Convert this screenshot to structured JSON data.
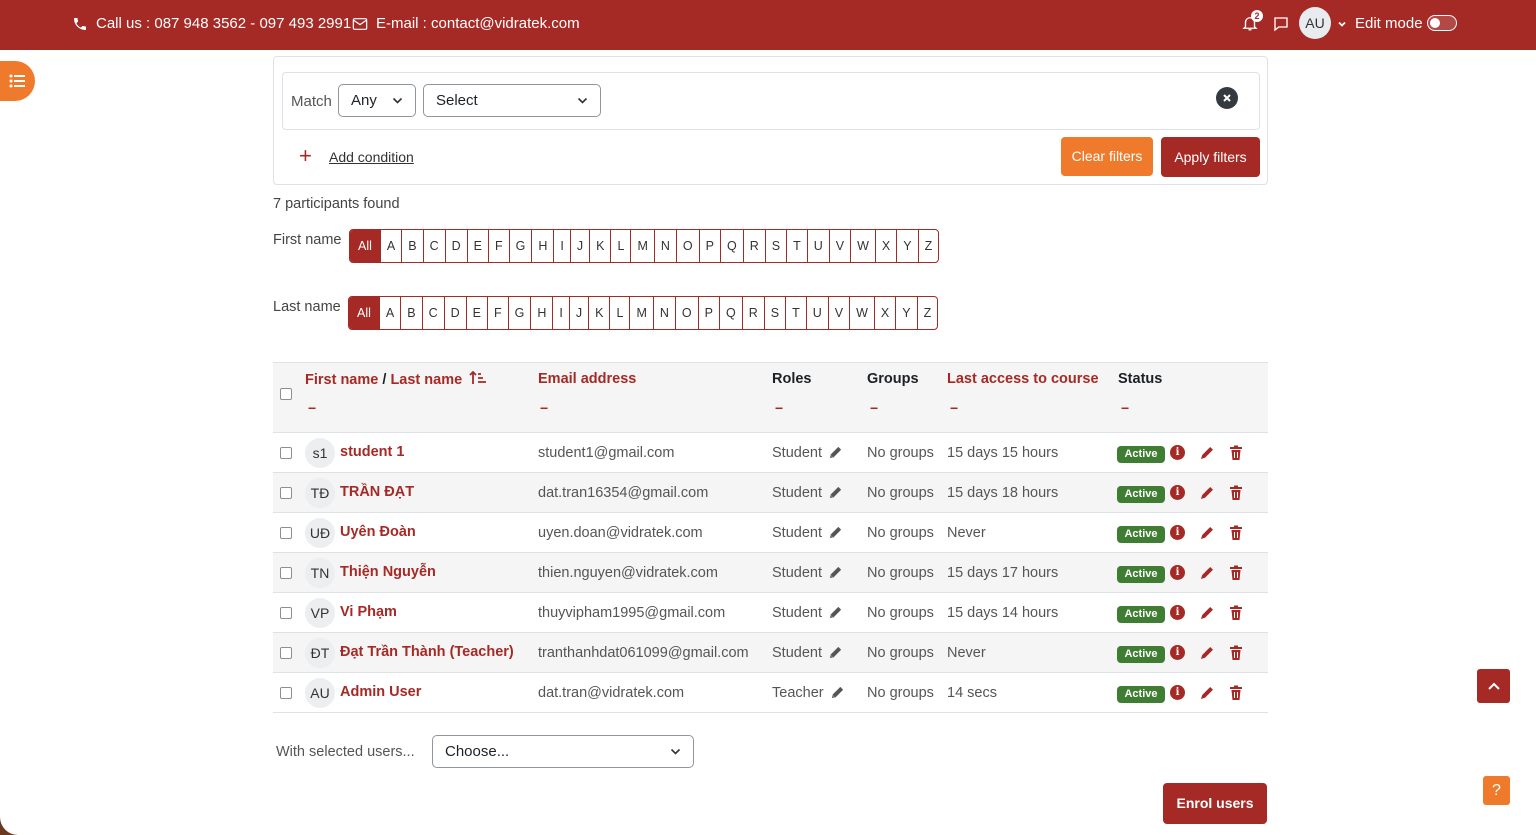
{
  "colors": {
    "brand": "#a52a26",
    "accent": "#f07a2c",
    "active": "#3e7d32"
  },
  "topbar": {
    "phone_icon": "phone-icon",
    "phone_text": "Call us : 087 948 3562 - 097 493 2991",
    "mail_icon": "envelope-icon",
    "email_text": "E-mail : contact@vidratek.com",
    "notification_count": "2",
    "avatar_initials": "AU",
    "edit_mode_label": "Edit mode"
  },
  "filters": {
    "match_label": "Match",
    "match_value": "Any",
    "select_value": "Select",
    "add_condition": "Add condition",
    "clear_label": "Clear filters",
    "apply_label": "Apply filters"
  },
  "participants_found": "7 participants found",
  "initials_bars": {
    "first_label": "First name",
    "last_label": "Last name",
    "letters": [
      "All",
      "A",
      "B",
      "C",
      "D",
      "E",
      "F",
      "G",
      "H",
      "I",
      "J",
      "K",
      "L",
      "M",
      "N",
      "O",
      "P",
      "Q",
      "R",
      "S",
      "T",
      "U",
      "V",
      "W",
      "X",
      "Y",
      "Z"
    ]
  },
  "table": {
    "headers": {
      "first": "First name",
      "sep": " / ",
      "last": "Last name",
      "sort_icon": "sort-ascending-icon",
      "email": "Email address",
      "roles": "Roles",
      "groups": "Groups",
      "last_access": "Last access to course",
      "status": "Status",
      "collapse": "−"
    },
    "rows": [
      {
        "initials": "s1",
        "name": "student 1",
        "email": "student1@gmail.com",
        "role": "Student",
        "groups": "No groups",
        "last_access": "15 days 15 hours",
        "status": "Active"
      },
      {
        "initials": "TĐ",
        "name": "TRẦN ĐẠT",
        "email": "dat.tran16354@gmail.com",
        "role": "Student",
        "groups": "No groups",
        "last_access": "15 days 18 hours",
        "status": "Active"
      },
      {
        "initials": "UĐ",
        "name": "Uyên Đoàn",
        "email": "uyen.doan@vidratek.com",
        "role": "Student",
        "groups": "No groups",
        "last_access": "Never",
        "status": "Active"
      },
      {
        "initials": "TN",
        "name": "Thiện Nguyễn",
        "email": "thien.nguyen@vidratek.com",
        "role": "Student",
        "groups": "No groups",
        "last_access": "15 days 17 hours",
        "status": "Active"
      },
      {
        "initials": "VP",
        "name": "Vi Phạm",
        "email": "thuyvipham1995@gmail.com",
        "role": "Student",
        "groups": "No groups",
        "last_access": "15 days 14 hours",
        "status": "Active"
      },
      {
        "initials": "ĐT",
        "name": "Đạt Trần Thành (Teacher)",
        "email": "tranthanhdat061099@gmail.com",
        "role": "Student",
        "groups": "No groups",
        "last_access": "Never",
        "status": "Active"
      },
      {
        "initials": "AU",
        "name": "Admin User",
        "email": "dat.tran@vidratek.com",
        "role": "Teacher",
        "groups": "No groups",
        "last_access": "14 secs",
        "status": "Active"
      }
    ]
  },
  "bulk": {
    "label": "With selected users...",
    "value": "Choose..."
  },
  "enrol_label": "Enrol users",
  "help_label": "?"
}
